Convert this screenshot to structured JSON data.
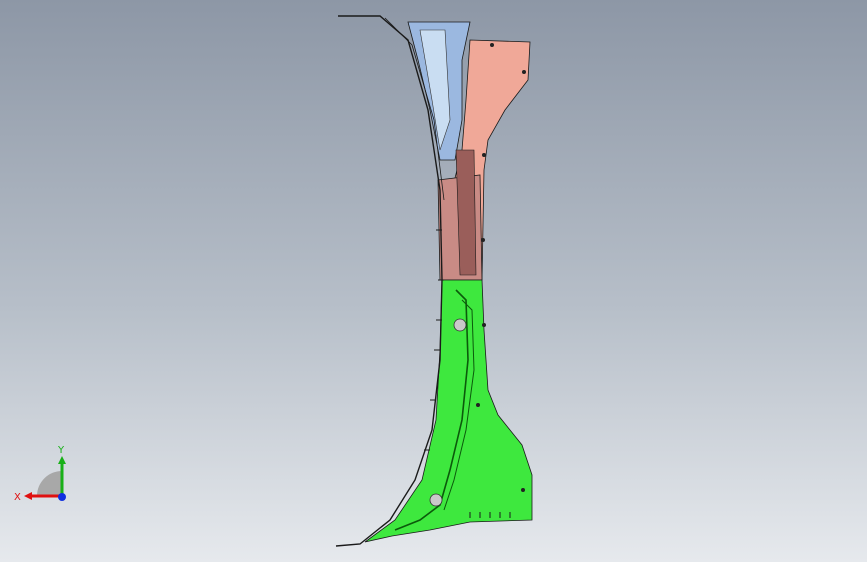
{
  "viewport": {
    "background_top": "#8d97a6",
    "background_bottom": "#e6e9ed"
  },
  "model": {
    "part_colors": {
      "upper_panel": "#f0a898",
      "blue_bracket": "#9bb8e0",
      "mid_panel": "#c98b85",
      "lower_panel": "#3ee83e",
      "edge": "#1a1a1a"
    }
  },
  "triad": {
    "x_label": "X",
    "y_label": "Y",
    "x_color": "#e01010",
    "y_color": "#18b018",
    "z_color": "#1030e0"
  }
}
